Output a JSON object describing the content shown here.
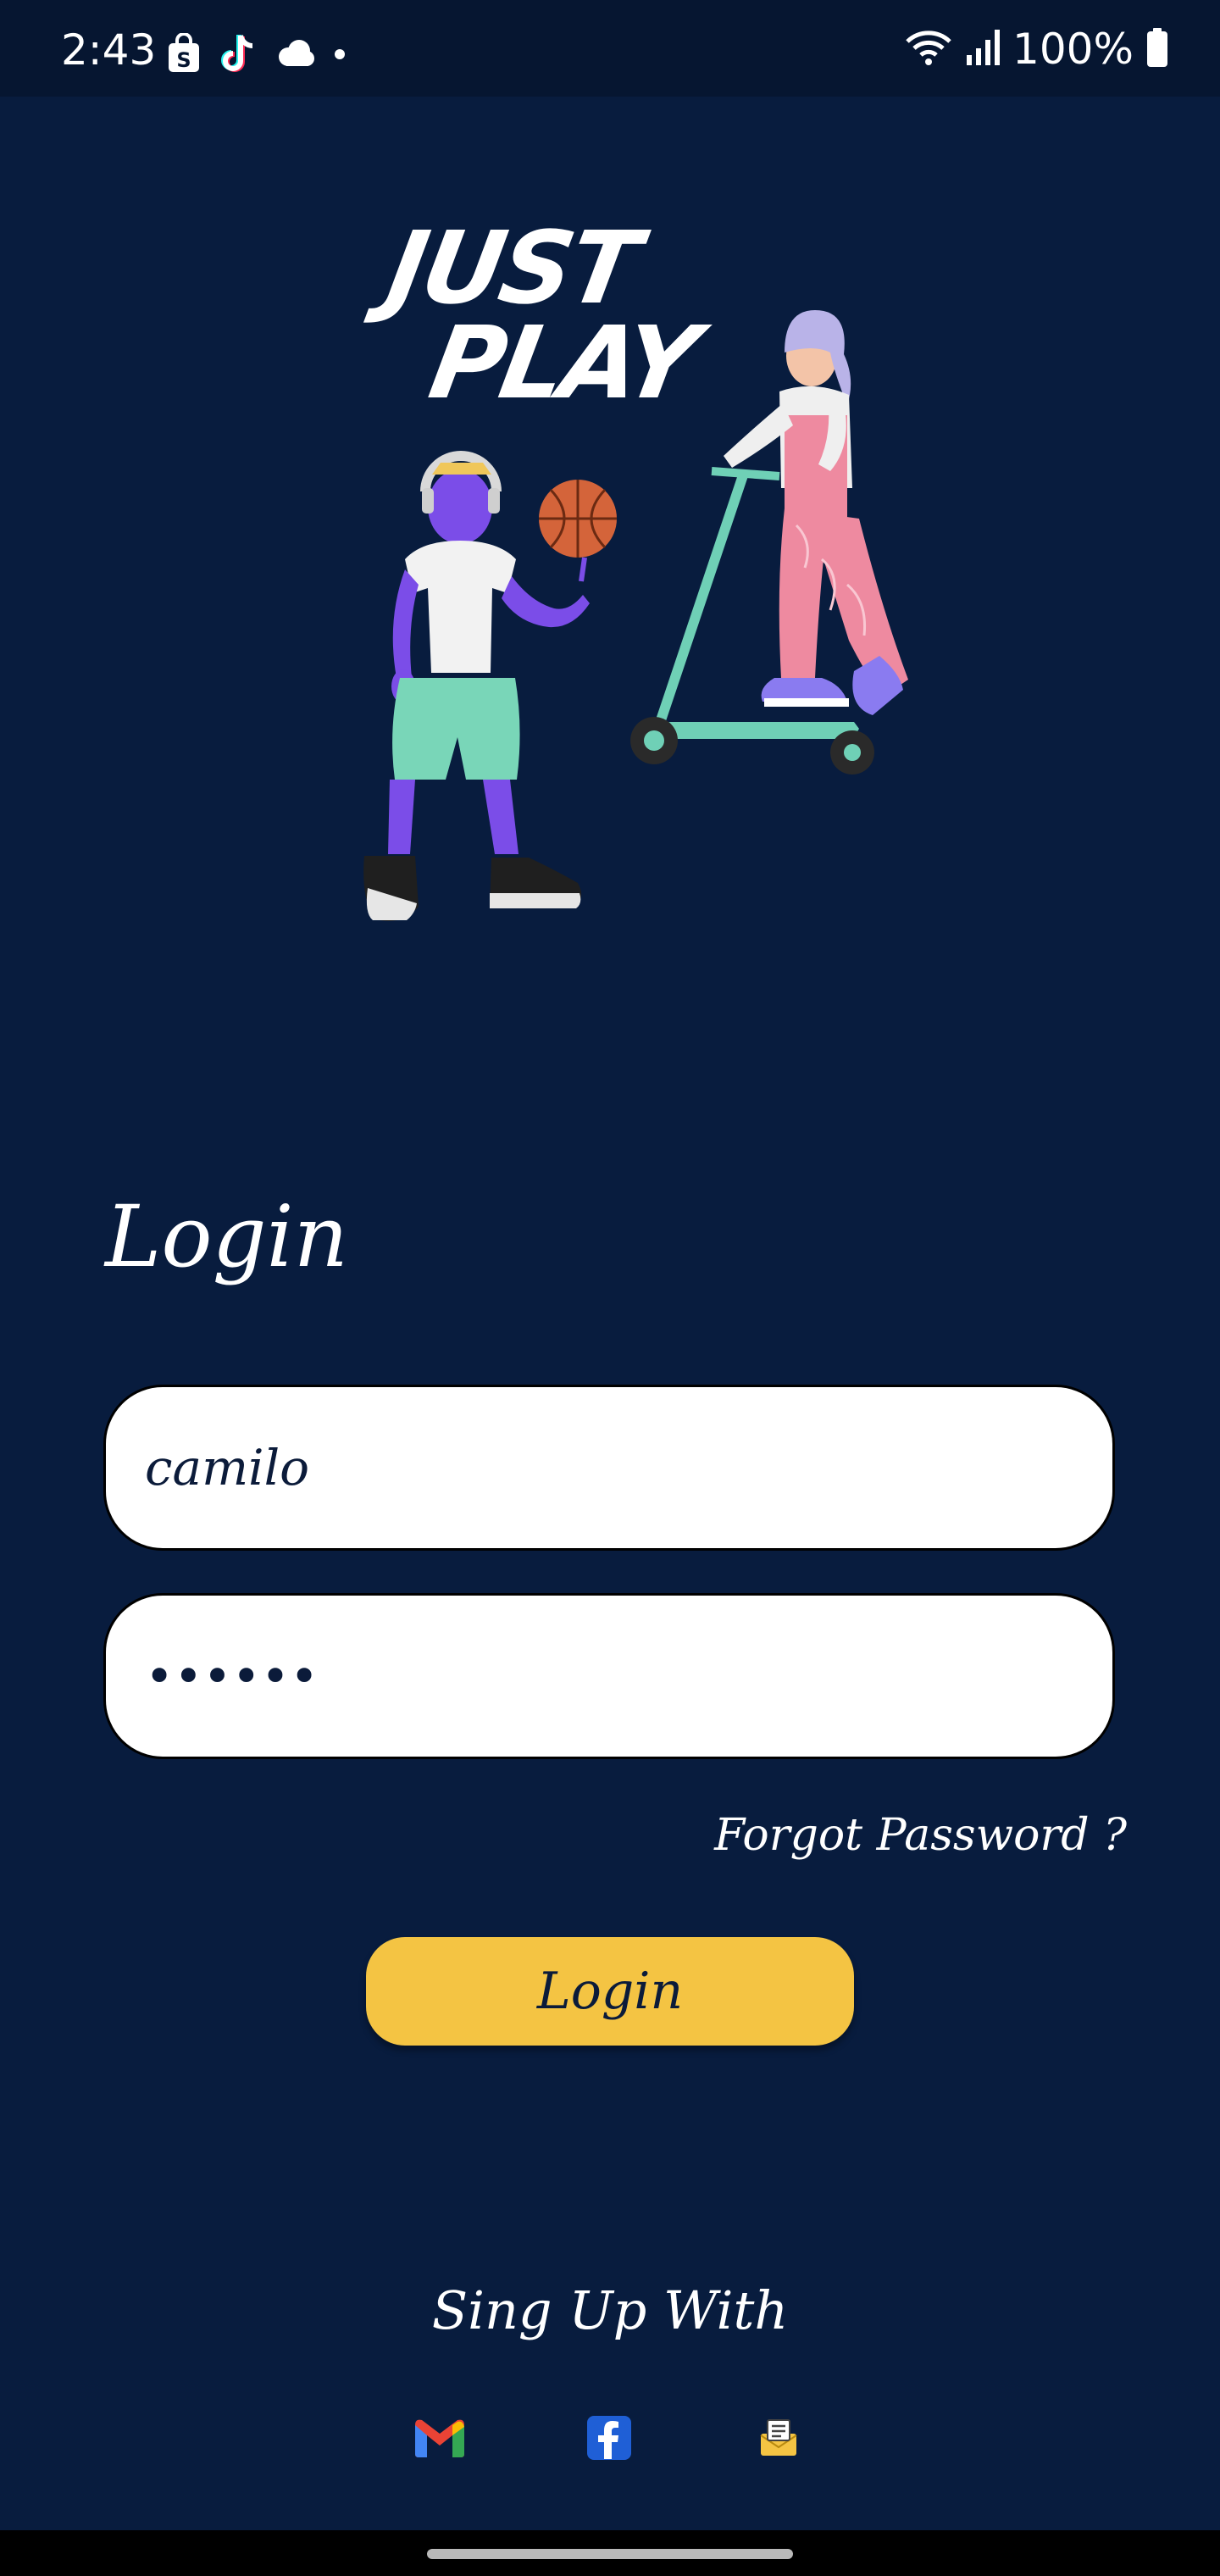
{
  "status_bar": {
    "time": "2:43",
    "battery_percent": "100%",
    "notification_icons": [
      "shopping-bag-icon",
      "tiktok-icon",
      "cloud-icon",
      "dot-icon"
    ],
    "system_icons": [
      "wifi-icon",
      "signal-icon",
      "battery-icon"
    ]
  },
  "hero": {
    "logo_line1": "JUST",
    "logo_line2": "PLAY"
  },
  "login": {
    "title": "Login",
    "username_value": "camilo",
    "password_value": "••••••",
    "forgot_password": "Forgot Password ?",
    "button_label": "Login"
  },
  "signup": {
    "label": "Sing Up With",
    "providers": [
      "gmail-icon",
      "facebook-icon",
      "mail-icon"
    ]
  },
  "colors": {
    "background": "#081c3e",
    "status_bar": "#061631",
    "accent_button": "#f4c443",
    "field_bg": "#ffffff",
    "text_dark": "#0b1b3a"
  }
}
